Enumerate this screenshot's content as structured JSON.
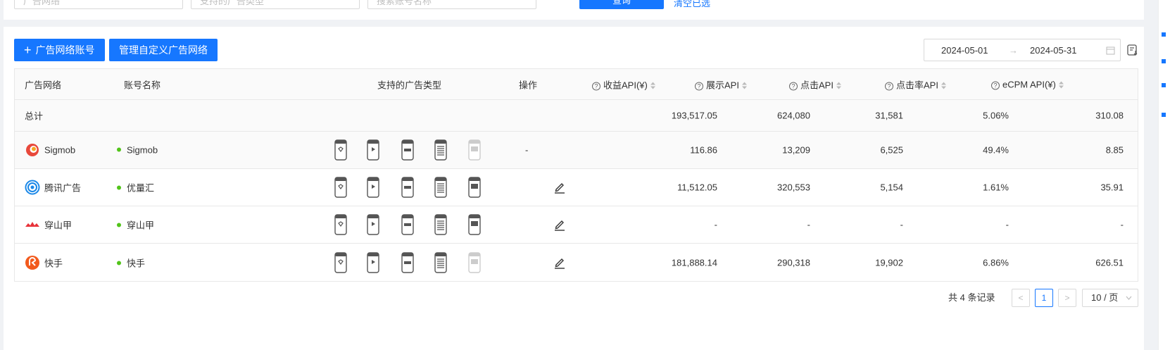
{
  "filters": {
    "network_placeholder": "广告网络",
    "adtype_placeholder": "支持的广告类型",
    "account_placeholder": "搜索账号名称",
    "query_label": "查询",
    "reset_label": "清空已选"
  },
  "toolbar": {
    "add_account_label": "广告网络账号",
    "manage_custom_label": "管理自定义广告网络",
    "date_start": "2024-05-01",
    "date_end": "2024-05-31",
    "arrow": "→"
  },
  "table": {
    "headers": {
      "network": "广告网络",
      "account": "账号名称",
      "ad_types": "支持的广告类型",
      "ops": "操作",
      "revenue": "收益API(¥)",
      "impressions": "展示API",
      "clicks": "点击API",
      "ctr": "点击率API",
      "ecpm": "eCPM API(¥)"
    },
    "total": {
      "label": "总计",
      "revenue": "193,517.05",
      "impressions": "624,080",
      "clicks": "31,581",
      "ctr": "5.06%",
      "ecpm": "310.08"
    },
    "rows": [
      {
        "network": "Sigmob",
        "account": "Sigmob",
        "ops": "-",
        "revenue": "116.86",
        "impressions": "13,209",
        "clicks": "6,525",
        "ctr": "49.4%",
        "ecpm": "8.85",
        "logo_color": "#e8483b"
      },
      {
        "network": "腾讯广告",
        "account": "优量汇",
        "ops": "",
        "revenue": "11,512.05",
        "impressions": "320,553",
        "clicks": "5,154",
        "ctr": "1.61%",
        "ecpm": "35.91",
        "logo_color": "#1a88e8"
      },
      {
        "network": "穿山甲",
        "account": "穿山甲",
        "ops": "",
        "revenue": "-",
        "impressions": "-",
        "clicks": "-",
        "ctr": "-",
        "ecpm": "-",
        "logo_color": "#e8333a"
      },
      {
        "network": "快手",
        "account": "快手",
        "ops": "",
        "revenue": "181,888.14",
        "impressions": "290,318",
        "clicks": "19,902",
        "ctr": "6.86%",
        "ecpm": "626.51",
        "logo_color": "#f25a1d"
      }
    ]
  },
  "pagination": {
    "total_text": "共 4 条记录",
    "prev": "<",
    "current": "1",
    "next": ">",
    "page_size": "10 / 页"
  },
  "colors": {
    "primary": "#1677ff",
    "status_green": "#52c41a"
  }
}
